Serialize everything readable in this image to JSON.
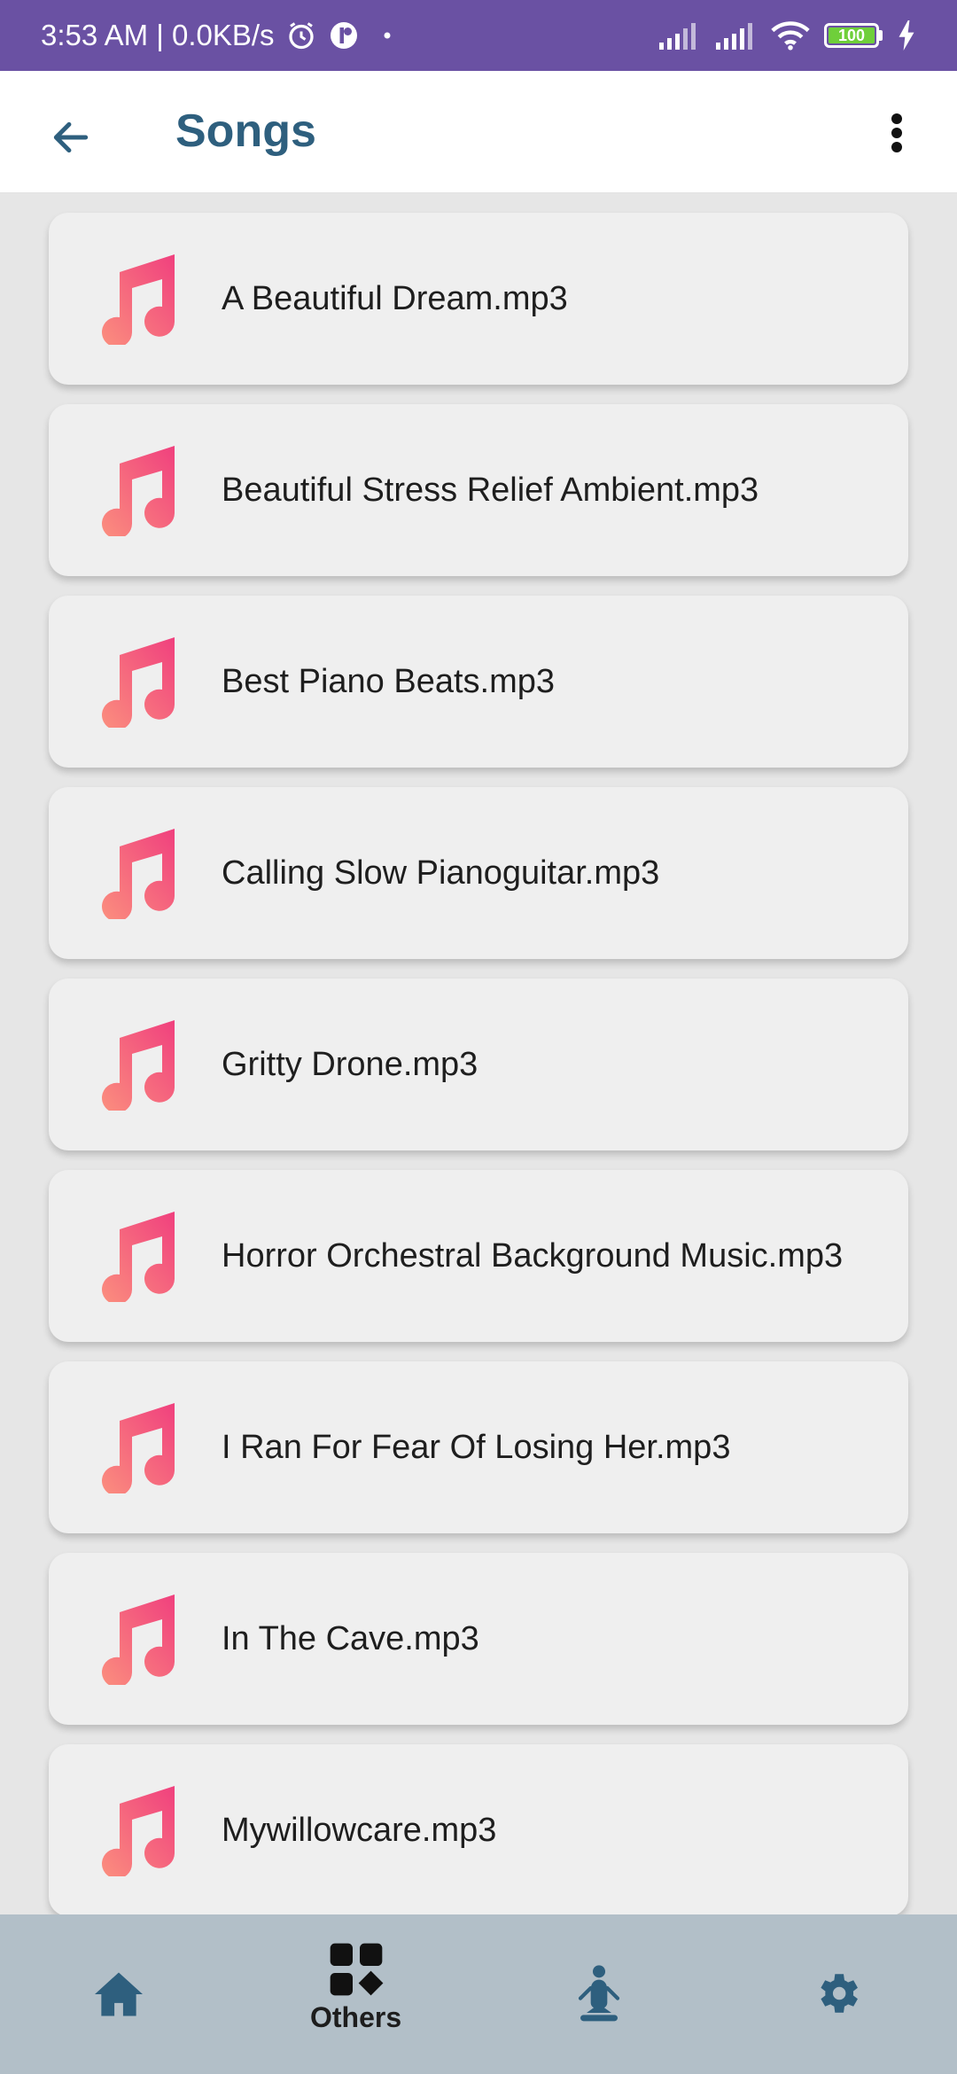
{
  "status_bar": {
    "time_speed": "3:53 AM | 0.0KB/s",
    "battery": "100",
    "icons": [
      "alarm-icon",
      "app-notification-icon",
      "dot-icon",
      "signal-icon",
      "signal-icon",
      "wifi-icon",
      "battery-icon",
      "charging-icon"
    ]
  },
  "app_bar": {
    "title": "Songs",
    "back_icon": "arrow-left-icon",
    "more_icon": "more-vertical-icon"
  },
  "songs": [
    "A Beautiful Dream.mp3",
    "Beautiful Stress Relief Ambient.mp3",
    "Best Piano Beats.mp3",
    "Calling Slow Pianoguitar.mp3",
    "Gritty Drone.mp3",
    "Horror Orchestral Background Music.mp3",
    "I Ran For Fear Of Losing Her.mp3",
    "In The Cave.mp3",
    "Mywillowcare.mp3"
  ],
  "bottom_nav": {
    "items": [
      {
        "icon": "home-icon",
        "label": ""
      },
      {
        "icon": "grid-icon",
        "label": "Others"
      },
      {
        "icon": "meditation-icon",
        "label": ""
      },
      {
        "icon": "settings-icon",
        "label": ""
      }
    ],
    "active_index": 1
  },
  "colors": {
    "status_bar": "#6a51a3",
    "title": "#2e5f7e",
    "nav_background": "#b2bfc8",
    "nav_icon": "#2e5f7e",
    "music_icon_gradient_start": "#fb8f7e",
    "music_icon_gradient_end": "#f0407e"
  }
}
